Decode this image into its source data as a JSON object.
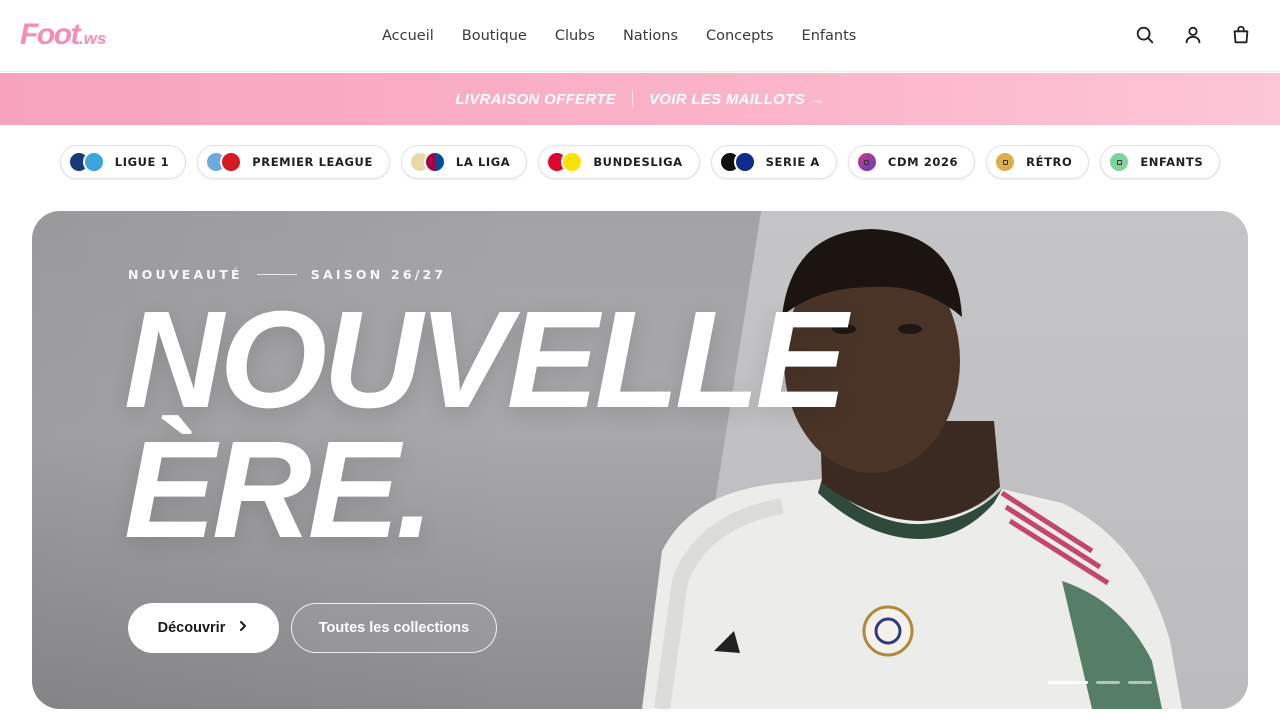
{
  "brand": {
    "logo_text": "Foot",
    "logo_suffix": ".ws",
    "accent_color": "#f58db4"
  },
  "nav": {
    "items": [
      {
        "label": "Accueil"
      },
      {
        "label": "Boutique"
      },
      {
        "label": "Clubs"
      },
      {
        "label": "Nations"
      },
      {
        "label": "Concepts"
      },
      {
        "label": "Enfants"
      }
    ]
  },
  "header_icons": [
    "search-icon",
    "user-icon",
    "cart-icon"
  ],
  "promo": {
    "left": "LIVRAISON OFFERTE",
    "right": "VOIR LES MAILLOTS →",
    "bg_color": "#fbb4c9"
  },
  "leagues": [
    {
      "label": "LIGUE 1",
      "crests": [
        "#1b3a7a",
        "#3fa3dc"
      ]
    },
    {
      "label": "PREMIER LEAGUE",
      "crests": [
        "#6cabdd",
        "#d71920"
      ]
    },
    {
      "label": "LA LIGA",
      "crests": [
        "#e9d9a8",
        "#a50044"
      ]
    },
    {
      "label": "BUNDESLIGA",
      "crests": [
        "#dc052d",
        "#fde100"
      ]
    },
    {
      "label": "SERIE A",
      "crests": [
        "#111111",
        "#0f2b8c"
      ]
    },
    {
      "label": "CDM 2026",
      "crests": [
        "#8a3cc8"
      ]
    },
    {
      "label": "RÉTRO",
      "crests": [
        "#d9b04a"
      ]
    },
    {
      "label": "ENFANTS",
      "crests": [
        "#7fd29a"
      ]
    }
  ],
  "hero": {
    "eyebrow_left": "NOUVEAUTÉ",
    "eyebrow_right": "SAISON 26/27",
    "headline_line1": "NOUVELLE",
    "headline_line2": "ÈRE.",
    "primary_button": "Découvrir",
    "secondary_button": "Toutes les collections",
    "slides": 3,
    "active_slide": 1
  }
}
